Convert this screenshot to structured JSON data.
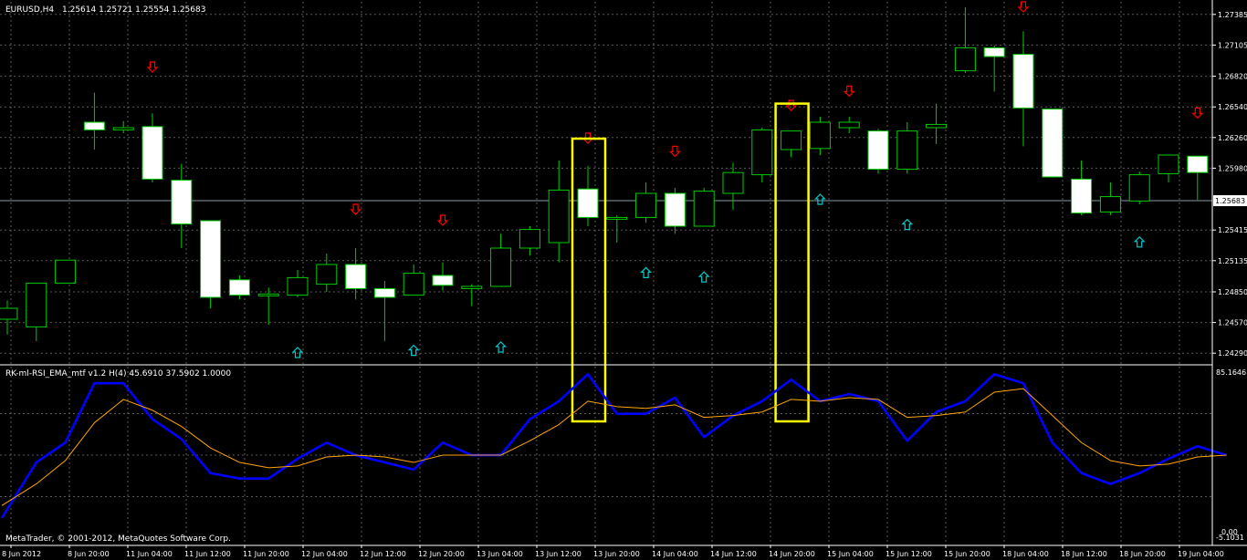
{
  "header": {
    "symbol": "EURUSD,H4",
    "ohlc": "1.25614 1.25721 1.25554 1.25683"
  },
  "indicator": {
    "label": "RK-ml-RSI_EMA_mtf v1.2 H(4) 45.6910 37.5902 1.0000"
  },
  "copyright": "MetaTrader, © 2001-2012, MetaQuotes Software Corp.",
  "colors": {
    "background": "#000000",
    "bull_body": "#000000",
    "bear_body": "#ffffff",
    "candle_outline": "#00cc00",
    "grid": "#5a5a5a",
    "rsi_line": "#0000ff",
    "ema_line": "#ffa500",
    "sell_arrow": "#ff0000",
    "buy_arrow": "#00cccc",
    "highlight_box": "#ffff00"
  },
  "chart_data": [
    {
      "type": "candlestick",
      "price_ticks": [
        "1.27385",
        "1.27105",
        "1.26820",
        "1.26540",
        "1.26260",
        "1.25980",
        "1.25415",
        "1.25135",
        "1.24850",
        "1.24570",
        "1.24290"
      ],
      "current_price": "1.25683",
      "ylim": [
        1.242,
        1.275
      ],
      "x_labels": [
        "8 Jun 2012",
        "8 Jun 20:00",
        "11 Jun 04:00",
        "11 Jun 12:00",
        "11 Jun 20:00",
        "12 Jun 04:00",
        "12 Jun 12:00",
        "12 Jun 20:00",
        "13 Jun 04:00",
        "13 Jun 12:00",
        "13 Jun 20:00",
        "14 Jun 04:00",
        "14 Jun 12:00",
        "14 Jun 20:00",
        "15 Jun 04:00",
        "15 Jun 12:00",
        "15 Jun 20:00",
        "18 Jun 04:00",
        "18 Jun 12:00",
        "18 Jun 20:00",
        "19 Jun 04:00"
      ],
      "candles": [
        [
          1.246,
          1.247,
          1.2446,
          1.2477
        ],
        [
          1.2453,
          1.2493,
          1.244,
          1.2493
        ],
        [
          1.2493,
          1.2514,
          1.2493,
          1.2514
        ],
        [
          1.264,
          1.2633,
          1.2615,
          1.2667
        ],
        [
          1.2633,
          1.2635,
          1.263,
          1.2641
        ],
        [
          1.2636,
          1.2588,
          1.2585,
          1.2648
        ],
        [
          1.2587,
          1.2547,
          1.2525,
          1.2602
        ],
        [
          1.255,
          1.248,
          1.247,
          1.255
        ],
        [
          1.2496,
          1.2482,
          1.2478,
          1.25
        ],
        [
          1.2482,
          1.2483,
          1.2455,
          1.2489
        ],
        [
          1.2482,
          1.2498,
          1.248,
          1.2505
        ],
        [
          1.2492,
          1.251,
          1.2485,
          1.252
        ],
        [
          1.251,
          1.2488,
          1.2478,
          1.2525
        ],
        [
          1.2488,
          1.248,
          1.244,
          1.2495
        ],
        [
          1.2482,
          1.2502,
          1.2482,
          1.251
        ],
        [
          1.25,
          1.2491,
          1.2486,
          1.2512
        ],
        [
          1.2488,
          1.249,
          1.2472,
          1.2492
        ],
        [
          1.249,
          1.2525,
          1.249,
          1.2538
        ],
        [
          1.2525,
          1.2542,
          1.2518,
          1.2545
        ],
        [
          1.253,
          1.2578,
          1.2512,
          1.2605
        ],
        [
          1.2579,
          1.2553,
          1.2545,
          1.26
        ],
        [
          1.2553,
          1.2553,
          1.253,
          1.2555
        ],
        [
          1.2553,
          1.2575,
          1.2548,
          1.2585
        ],
        [
          1.2575,
          1.2545,
          1.2538,
          1.258
        ],
        [
          1.2545,
          1.2577,
          1.2545,
          1.258
        ],
        [
          1.2575,
          1.2594,
          1.256,
          1.2603
        ],
        [
          1.2592,
          1.2633,
          1.2585,
          1.2635
        ],
        [
          1.2615,
          1.2632,
          1.2608,
          1.2632
        ],
        [
          1.2616,
          1.264,
          1.261,
          1.2645
        ],
        [
          1.2635,
          1.264,
          1.263,
          1.2645
        ],
        [
          1.2632,
          1.2597,
          1.2593,
          1.2634
        ],
        [
          1.2597,
          1.2632,
          1.2593,
          1.264
        ],
        [
          1.2635,
          1.2638,
          1.262,
          1.2657
        ],
        [
          1.2687,
          1.2708,
          1.2685,
          1.2745
        ],
        [
          1.2708,
          1.27,
          1.2668,
          1.271
        ],
        [
          1.2702,
          1.2653,
          1.2618,
          1.2723
        ],
        [
          1.2652,
          1.259,
          1.259,
          1.2652
        ],
        [
          1.2588,
          1.2557,
          1.2555,
          1.2605
        ],
        [
          1.2558,
          1.2572,
          1.2555,
          1.2585
        ],
        [
          1.2568,
          1.2592,
          1.2565,
          1.2595
        ],
        [
          1.2593,
          1.261,
          1.2585,
          1.261
        ],
        [
          1.2609,
          1.2594,
          1.2569,
          1.2609
        ]
      ],
      "sell_arrows": [
        [
          5,
          1.269
        ],
        [
          12,
          1.256
        ],
        [
          15,
          1.255
        ],
        [
          20,
          1.2625
        ],
        [
          23,
          1.2613
        ],
        [
          27,
          1.2655
        ],
        [
          29,
          1.2668
        ],
        [
          35,
          1.2745
        ],
        [
          41,
          1.2648
        ]
      ],
      "buy_arrows": [
        [
          10,
          1.243
        ],
        [
          14,
          1.2432
        ],
        [
          17,
          1.2435
        ],
        [
          22,
          1.2503
        ],
        [
          24,
          1.2499
        ],
        [
          28,
          1.257
        ],
        [
          31,
          1.2547
        ],
        [
          39,
          1.2531
        ]
      ],
      "highlighted_candles": [
        20,
        27
      ]
    },
    {
      "type": "line",
      "title": "RK-ml-RSI_EMA_mtf v1.2 H(4)",
      "y_ticks": [
        "85.1646",
        "-5.1031",
        "0.00"
      ],
      "ylim": [
        -5.1031,
        85.1646
      ],
      "series": [
        {
          "values": [
            5,
            36,
            47,
            80,
            80,
            60,
            49,
            30,
            27,
            27,
            38,
            47,
            40,
            36,
            32,
            47,
            40,
            40,
            60,
            70,
            85,
            63,
            63,
            72,
            50,
            62,
            70,
            82,
            70,
            74,
            70,
            48,
            64,
            70,
            85,
            80,
            47,
            30,
            24,
            30,
            38,
            45,
            40
          ]
        },
        {
          "values": [
            12,
            24,
            37,
            58,
            71,
            65,
            56,
            44,
            36,
            33,
            34,
            39,
            40,
            39,
            36,
            40,
            40,
            40,
            48,
            57,
            70,
            67,
            66,
            68,
            61,
            62,
            64,
            71,
            70,
            72,
            71,
            61,
            62,
            64,
            75,
            77,
            62,
            47,
            37,
            34,
            35,
            39,
            40
          ]
        }
      ]
    }
  ]
}
